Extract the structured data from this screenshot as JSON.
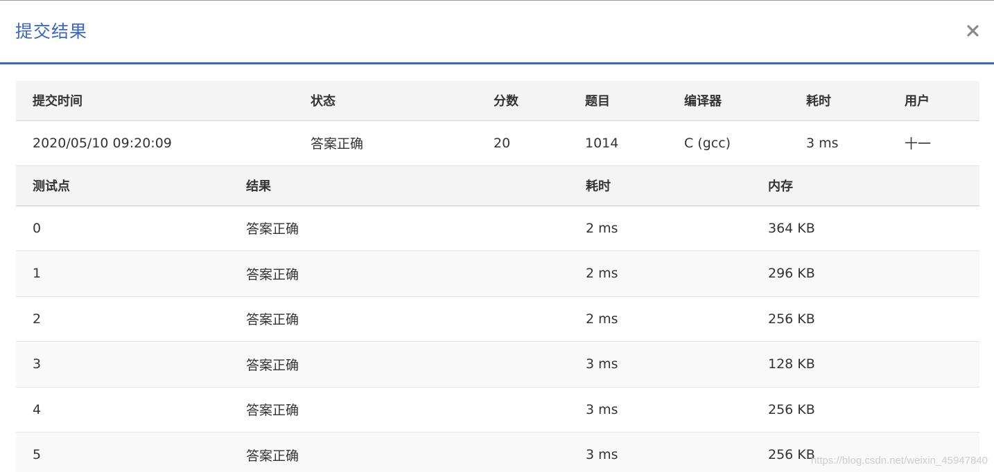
{
  "dialog": {
    "title": "提交结果"
  },
  "icons": {
    "close": "close-icon"
  },
  "colors": {
    "accent": "#3b66c4",
    "status_ok": "#e03232",
    "link": "#1a4f9c"
  },
  "summary": {
    "headers": {
      "time": "提交时间",
      "status": "状态",
      "score": "分数",
      "problem": "题目",
      "compiler": "编译器",
      "duration": "耗时",
      "user": "用户"
    },
    "row": {
      "time": "2020/05/10 09:20:09",
      "status": "答案正确",
      "score": "20",
      "problem": "1014",
      "compiler": "C (gcc)",
      "duration": "3 ms",
      "user": "十一"
    }
  },
  "cases": {
    "headers": {
      "id": "测试点",
      "result": "结果",
      "duration": "耗时",
      "memory": "内存"
    },
    "rows": [
      {
        "id": "0",
        "result": "答案正确",
        "duration": "2 ms",
        "memory": "364 KB"
      },
      {
        "id": "1",
        "result": "答案正确",
        "duration": "2 ms",
        "memory": "296 KB"
      },
      {
        "id": "2",
        "result": "答案正确",
        "duration": "2 ms",
        "memory": "256 KB"
      },
      {
        "id": "3",
        "result": "答案正确",
        "duration": "3 ms",
        "memory": "128 KB"
      },
      {
        "id": "4",
        "result": "答案正确",
        "duration": "3 ms",
        "memory": "256 KB"
      },
      {
        "id": "5",
        "result": "答案正确",
        "duration": "3 ms",
        "memory": "256 KB"
      }
    ]
  },
  "watermark": "https://blog.csdn.net/weixin_45947840"
}
